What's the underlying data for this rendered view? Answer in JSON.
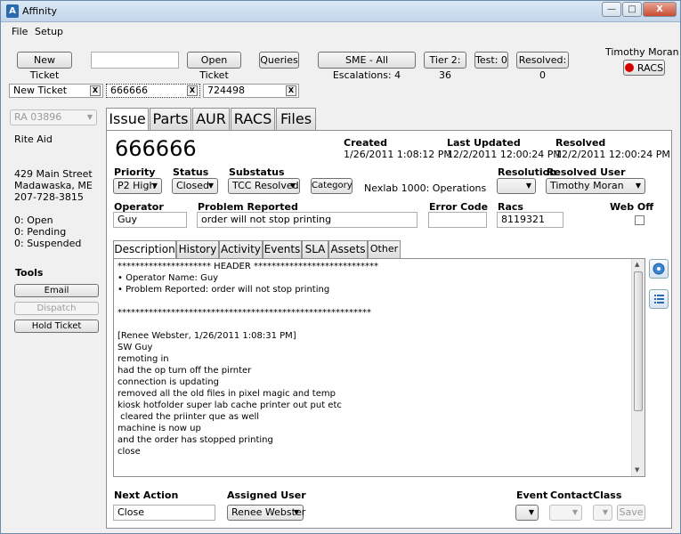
{
  "window": {
    "title": "Affinity",
    "min": "—",
    "max": "□",
    "close": "X"
  },
  "menu": [
    "File",
    "Setup"
  ],
  "toolbar": {
    "new_ticket": "New Ticket",
    "search_value": "",
    "open_ticket": "Open Ticket",
    "queries": "Queries",
    "sme": "SME - All Escalations: 4",
    "tier2": "Tier 2: 36",
    "test": "Test: 0",
    "resolved": "Resolved: 0",
    "user": "Timothy Moran",
    "racs": "RACS"
  },
  "doc_tabs": [
    {
      "label": "New Ticket",
      "close": "X"
    },
    {
      "label": "666666",
      "close": "X"
    },
    {
      "label": "724498",
      "close": "X"
    }
  ],
  "left": {
    "store_select": "RA 03896",
    "store_name": "Rite Aid",
    "address1": "429 Main Street",
    "address2": "Madawaska, ME",
    "phone": "207-728-3815",
    "open": "0: Open",
    "pending": "0: Pending",
    "suspended": "0: Suspended",
    "tools_title": "Tools",
    "email": "Email",
    "dispatch": "Dispatch",
    "hold": "Hold Ticket"
  },
  "main_tabs": [
    "Issue",
    "Parts",
    "AUR",
    "RACS",
    "Files"
  ],
  "issue": {
    "ticket_number": "666666",
    "created_label": "Created",
    "created_value": "1/26/2011 1:08:12 PM",
    "updated_label": "Last Updated",
    "updated_value": "12/2/2011 12:00:24 PM",
    "resolved_label": "Resolved",
    "resolved_value": "12/2/2011 12:00:24 PM",
    "priority_label": "Priority",
    "priority_value": "P2 High",
    "status_label": "Status",
    "status_value": "Closed",
    "substatus_label": "Substatus",
    "substatus_value": "TCC Resolved",
    "category_button": "Category",
    "category_value": "Nexlab 1000: Operations",
    "resolution_label": "Resolution",
    "resolution_value": "",
    "resolved_user_label": "Resolved User",
    "resolved_user_value": "Timothy Moran",
    "operator_label": "Operator",
    "operator_value": "Guy",
    "problem_label": "Problem Reported",
    "problem_value": "order will not stop printing",
    "error_code_label": "Error Code",
    "error_code_value": "",
    "racs_label": "Racs",
    "racs_value": "8119321",
    "web_off_label": "Web Off"
  },
  "sub_tabs": [
    "Description",
    "History",
    "Activity",
    "Events",
    "SLA",
    "Assets",
    "Other"
  ],
  "description": "********************* HEADER ****************************\n• Operator Name: Guy\n• Problem Reported: order will not stop printing\n\n*********************************************************\n\n[Renee Webster, 1/26/2011 1:08:31 PM]\nSW Guy\nremoting in\nhad the op turn off the pirnter\nconnection is updating\nremoved all the old files in pixel magic and temp\nkiosk hotfolder super lab cache printer out put etc\n cleared the priinter que as well\nmachine is now up\nand the order has stopped printing\nclose",
  "footer": {
    "next_action_label": "Next Action",
    "next_action_value": "Close",
    "assigned_label": "Assigned User",
    "assigned_value": "Renee Webster",
    "event_label": "Event",
    "contact_label": "Contact",
    "class_label": "Class",
    "save": "Save"
  }
}
